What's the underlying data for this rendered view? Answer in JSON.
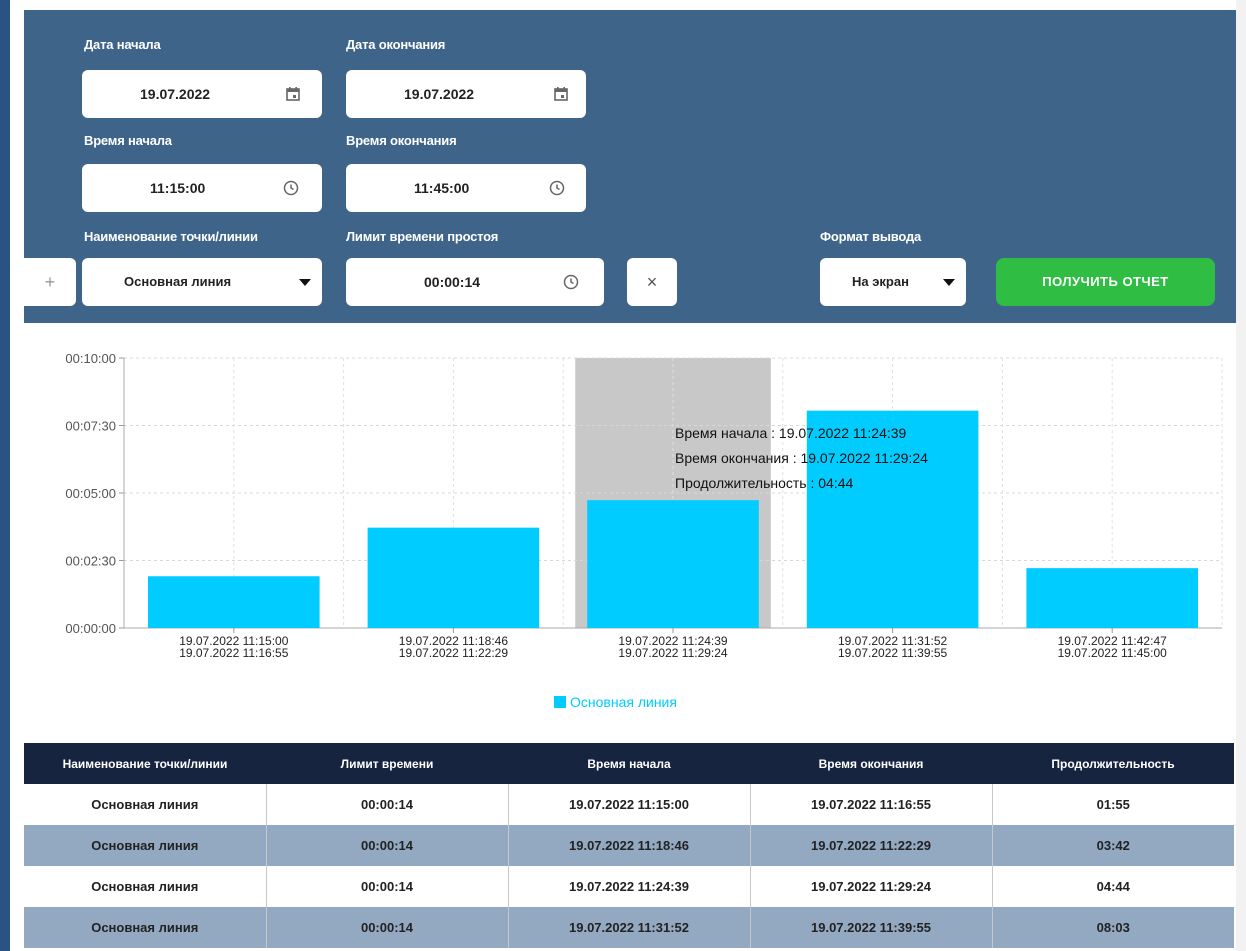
{
  "form": {
    "start_date_label": "Дата начала",
    "start_date_value": "19.07.2022",
    "end_date_label": "Дата окончания",
    "end_date_value": "19.07.2022",
    "start_time_label": "Время начала",
    "start_time_value": "11:15:00",
    "end_time_label": "Время окончания",
    "end_time_value": "11:45:00",
    "point_label": "Наименование точки/линии",
    "point_value": "Основная линия",
    "idle_limit_label": "Лимит времени простоя",
    "idle_limit_value": "00:00:14",
    "output_format_label": "Формат вывода",
    "output_format_value": "На экран",
    "add_button": "+",
    "clear_button": "×",
    "report_button": "ПОЛУЧИТЬ ОТЧЕТ"
  },
  "colors": {
    "panel": "#3e6489",
    "bar": "#00ccff",
    "highlight": "#c8c8c8",
    "report_button": "#2fbd44",
    "table_header": "#172440",
    "table_even_row": "#93a9c1"
  },
  "icons": {
    "date": "calendar-icon",
    "time": "clock-icon",
    "dropdown": "caret-down-icon",
    "clear": "close-icon",
    "add": "plus-icon"
  },
  "chart_data": {
    "type": "bar",
    "categories": [
      [
        "19.07.2022 11:15:00",
        "19.07.2022 11:16:55"
      ],
      [
        "19.07.2022 11:18:46",
        "19.07.2022 11:22:29"
      ],
      [
        "19.07.2022 11:24:39",
        "19.07.2022 11:29:24"
      ],
      [
        "19.07.2022 11:31:52",
        "19.07.2022 11:39:55"
      ],
      [
        "19.07.2022 11:42:47",
        "19.07.2022 11:45:00"
      ]
    ],
    "series": [
      {
        "name": "Основная линия",
        "values_seconds": [
          115,
          223,
          284,
          483,
          133
        ]
      }
    ],
    "y_ticks": [
      "00:00:00",
      "00:02:30",
      "00:05:00",
      "00:07:30",
      "00:10:00"
    ],
    "ylim_seconds": [
      0,
      600
    ],
    "grid": true,
    "legend": "bottom-center",
    "highlighted_index": 2,
    "tooltip": [
      "Время начала : 19.07.2022 11:24:39",
      "Время окончания : 19.07.2022 11:29:24",
      "Продолжительность : 04:44"
    ]
  },
  "table": {
    "headers": [
      "Наименование точки/линии",
      "Лимит времени",
      "Время начала",
      "Время окончания",
      "Продолжительность"
    ],
    "rows": [
      [
        "Основная линия",
        "00:00:14",
        "19.07.2022 11:15:00",
        "19.07.2022 11:16:55",
        "01:55"
      ],
      [
        "Основная линия",
        "00:00:14",
        "19.07.2022 11:18:46",
        "19.07.2022 11:22:29",
        "03:42"
      ],
      [
        "Основная линия",
        "00:00:14",
        "19.07.2022 11:24:39",
        "19.07.2022 11:29:24",
        "04:44"
      ],
      [
        "Основная линия",
        "00:00:14",
        "19.07.2022 11:31:52",
        "19.07.2022 11:39:55",
        "08:03"
      ]
    ]
  }
}
